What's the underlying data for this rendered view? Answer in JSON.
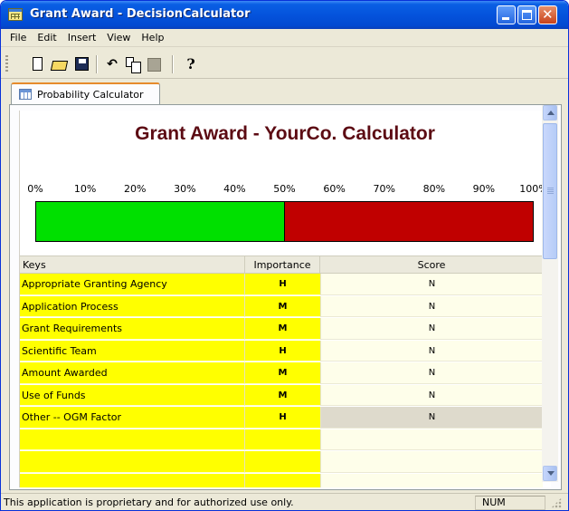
{
  "window": {
    "title": "Grant Award - DecisionCalculator"
  },
  "menu": [
    "File",
    "Edit",
    "Insert",
    "View",
    "Help"
  ],
  "toolbar": {
    "icons": [
      "new-document-icon",
      "open-folder-icon",
      "save-icon",
      "undo-icon",
      "copy-icon",
      "paste-icon",
      "help-icon"
    ]
  },
  "tab": {
    "label": "Probability Calculator"
  },
  "calculator": {
    "title": "Grant Award - YourCo. Calculator",
    "percent_labels": [
      "0%",
      "10%",
      "20%",
      "30%",
      "40%",
      "50%",
      "60%",
      "70%",
      "80%",
      "90%",
      "100%"
    ],
    "probability": 0.5,
    "colors": {
      "yes": "#00e000",
      "no": "#c00000",
      "title": "#5c0b13",
      "key_bg": "#ffff00"
    }
  },
  "grid": {
    "headers": {
      "keys": "Keys",
      "importance": "Importance",
      "score": "Score"
    },
    "rows": [
      {
        "key": "Appropriate Granting Agency",
        "importance": "H",
        "score": "N"
      },
      {
        "key": "Application Process",
        "importance": "M",
        "score": "N"
      },
      {
        "key": "Grant Requirements",
        "importance": "M",
        "score": "N"
      },
      {
        "key": "Scientific Team",
        "importance": "H",
        "score": "N"
      },
      {
        "key": "Amount Awarded",
        "importance": "M",
        "score": "N"
      },
      {
        "key": "Use of Funds",
        "importance": "M",
        "score": "N"
      },
      {
        "key": "Other -- OGM Factor",
        "importance": "H",
        "score": "N"
      }
    ],
    "selected_row": 6,
    "empty_rows": 3
  },
  "status": {
    "message": "This application is proprietary and for authorized use only.",
    "num": "NUM"
  }
}
